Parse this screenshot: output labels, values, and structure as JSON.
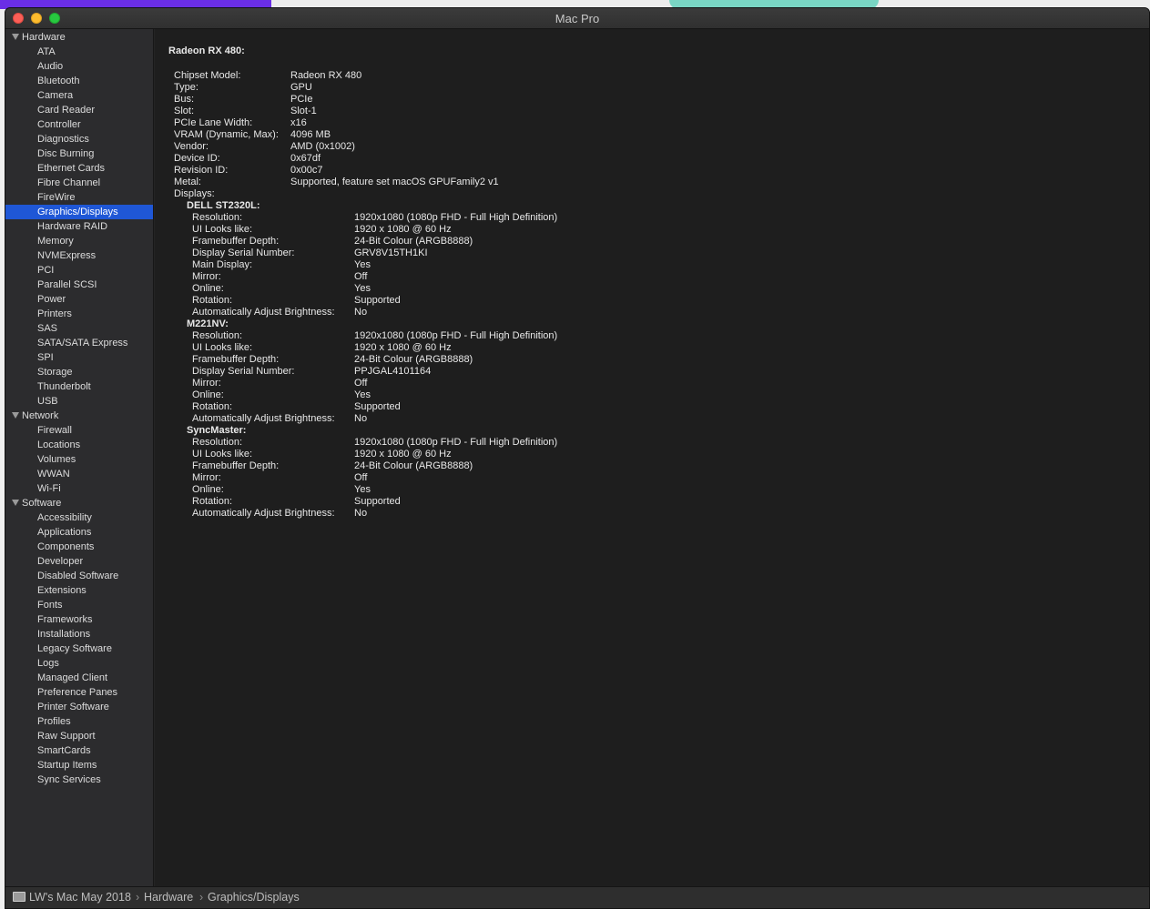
{
  "window": {
    "title": "Mac Pro"
  },
  "sidebar": {
    "groups": [
      {
        "label": "Hardware",
        "items": [
          "ATA",
          "Audio",
          "Bluetooth",
          "Camera",
          "Card Reader",
          "Controller",
          "Diagnostics",
          "Disc Burning",
          "Ethernet Cards",
          "Fibre Channel",
          "FireWire",
          "Graphics/Displays",
          "Hardware RAID",
          "Memory",
          "NVMExpress",
          "PCI",
          "Parallel SCSI",
          "Power",
          "Printers",
          "SAS",
          "SATA/SATA Express",
          "SPI",
          "Storage",
          "Thunderbolt",
          "USB"
        ]
      },
      {
        "label": "Network",
        "items": [
          "Firewall",
          "Locations",
          "Volumes",
          "WWAN",
          "Wi-Fi"
        ]
      },
      {
        "label": "Software",
        "items": [
          "Accessibility",
          "Applications",
          "Components",
          "Developer",
          "Disabled Software",
          "Extensions",
          "Fonts",
          "Frameworks",
          "Installations",
          "Legacy Software",
          "Logs",
          "Managed Client",
          "Preference Panes",
          "Printer Software",
          "Profiles",
          "Raw Support",
          "SmartCards",
          "Startup Items",
          "Sync Services"
        ]
      }
    ],
    "selected": "Graphics/Displays"
  },
  "detail": {
    "heading": "Radeon RX 480:",
    "properties": [
      {
        "label": "Chipset Model:",
        "value": "Radeon RX 480"
      },
      {
        "label": "Type:",
        "value": "GPU"
      },
      {
        "label": "Bus:",
        "value": "PCIe"
      },
      {
        "label": "Slot:",
        "value": "Slot-1"
      },
      {
        "label": "PCIe Lane Width:",
        "value": "x16"
      },
      {
        "label": "VRAM (Dynamic, Max):",
        "value": "4096 MB"
      },
      {
        "label": "Vendor:",
        "value": "AMD (0x1002)"
      },
      {
        "label": "Device ID:",
        "value": "0x67df"
      },
      {
        "label": "Revision ID:",
        "value": "0x00c7"
      },
      {
        "label": "Metal:",
        "value": "Supported, feature set macOS GPUFamily2 v1"
      },
      {
        "label": "Displays:",
        "value": ""
      }
    ],
    "displays": [
      {
        "name": "DELL ST2320L:",
        "properties": [
          {
            "label": "Resolution:",
            "value": "1920x1080 (1080p FHD - Full High Definition)"
          },
          {
            "label": "UI Looks like:",
            "value": "1920 x 1080 @ 60 Hz"
          },
          {
            "label": "Framebuffer Depth:",
            "value": "24-Bit Colour (ARGB8888)"
          },
          {
            "label": "Display Serial Number:",
            "value": "GRV8V15TH1KI"
          },
          {
            "label": "Main Display:",
            "value": "Yes"
          },
          {
            "label": "Mirror:",
            "value": "Off"
          },
          {
            "label": "Online:",
            "value": "Yes"
          },
          {
            "label": "Rotation:",
            "value": "Supported"
          },
          {
            "label": "Automatically Adjust Brightness:",
            "value": "No"
          }
        ]
      },
      {
        "name": "M221NV:",
        "properties": [
          {
            "label": "Resolution:",
            "value": "1920x1080 (1080p FHD - Full High Definition)"
          },
          {
            "label": "UI Looks like:",
            "value": "1920 x 1080 @ 60 Hz"
          },
          {
            "label": "Framebuffer Depth:",
            "value": "24-Bit Colour (ARGB8888)"
          },
          {
            "label": "Display Serial Number:",
            "value": "PPJGAL4101164"
          },
          {
            "label": "Mirror:",
            "value": "Off"
          },
          {
            "label": "Online:",
            "value": "Yes"
          },
          {
            "label": "Rotation:",
            "value": "Supported"
          },
          {
            "label": "Automatically Adjust Brightness:",
            "value": "No"
          }
        ]
      },
      {
        "name": "SyncMaster:",
        "properties": [
          {
            "label": "Resolution:",
            "value": "1920x1080 (1080p FHD - Full High Definition)"
          },
          {
            "label": "UI Looks like:",
            "value": "1920 x 1080 @ 60 Hz"
          },
          {
            "label": "Framebuffer Depth:",
            "value": "24-Bit Colour (ARGB8888)"
          },
          {
            "label": "Mirror:",
            "value": "Off"
          },
          {
            "label": "Online:",
            "value": "Yes"
          },
          {
            "label": "Rotation:",
            "value": "Supported"
          },
          {
            "label": "Automatically Adjust Brightness:",
            "value": "No"
          }
        ]
      }
    ]
  },
  "pathbar": {
    "icon": "computer-icon",
    "crumbs": [
      "LW's Mac May 2018",
      "Hardware",
      "Graphics/Displays"
    ],
    "separator": "›"
  },
  "colors": {
    "selection": "#1f57d6",
    "content_bg": "#1e1e1e",
    "sidebar_bg": "#2c2c2e"
  }
}
